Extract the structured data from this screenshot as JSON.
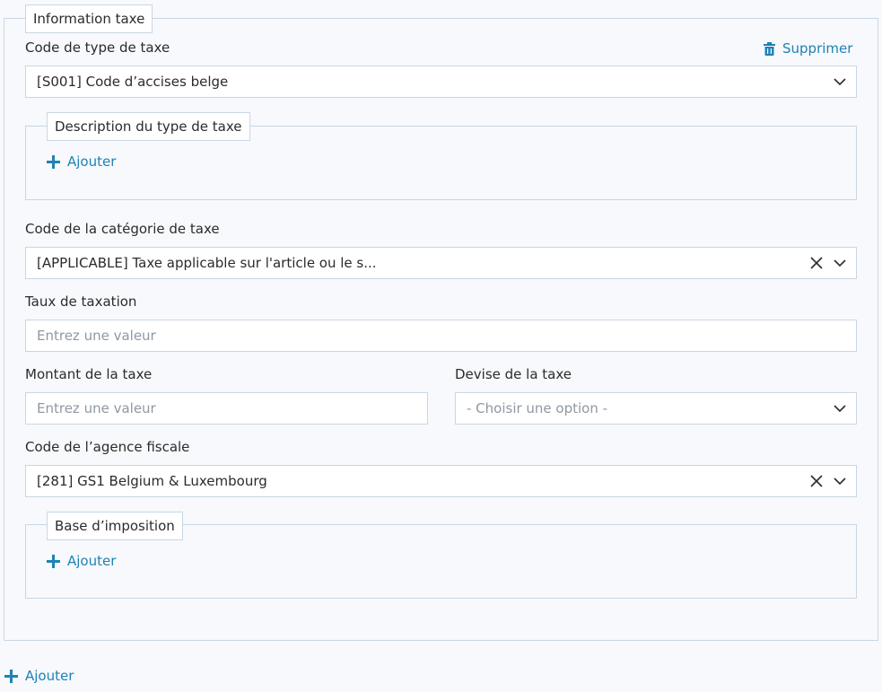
{
  "tax_info": {
    "legend": "Information taxe",
    "delete_label": "Supprimer",
    "tax_type_code": {
      "label": "Code de type de taxe",
      "value": "[S001] Code d’accises belge"
    },
    "tax_type_description": {
      "legend": "Description du type de taxe",
      "add_label": "Ajouter"
    },
    "tax_category_code": {
      "label": "Code de la catégorie de taxe",
      "value": "[APPLICABLE] Taxe applicable sur l'article ou le s..."
    },
    "tax_rate": {
      "label": "Taux de taxation",
      "placeholder": "Entrez une valeur"
    },
    "tax_amount": {
      "label": "Montant de la taxe",
      "placeholder": "Entrez une valeur"
    },
    "tax_currency": {
      "label": "Devise de la taxe",
      "placeholder": "- Choisir une option -"
    },
    "tax_agency_code": {
      "label": "Code de l’agence fiscale",
      "value": "[281] GS1 Belgium & Luxembourg"
    },
    "tax_basis": {
      "legend": "Base d’imposition",
      "add_label": "Ajouter"
    }
  },
  "footer": {
    "add_label": "Ajouter"
  },
  "colors": {
    "accent": "#1f82b4",
    "border": "#c9d6e3",
    "background": "#f7f9fc"
  }
}
